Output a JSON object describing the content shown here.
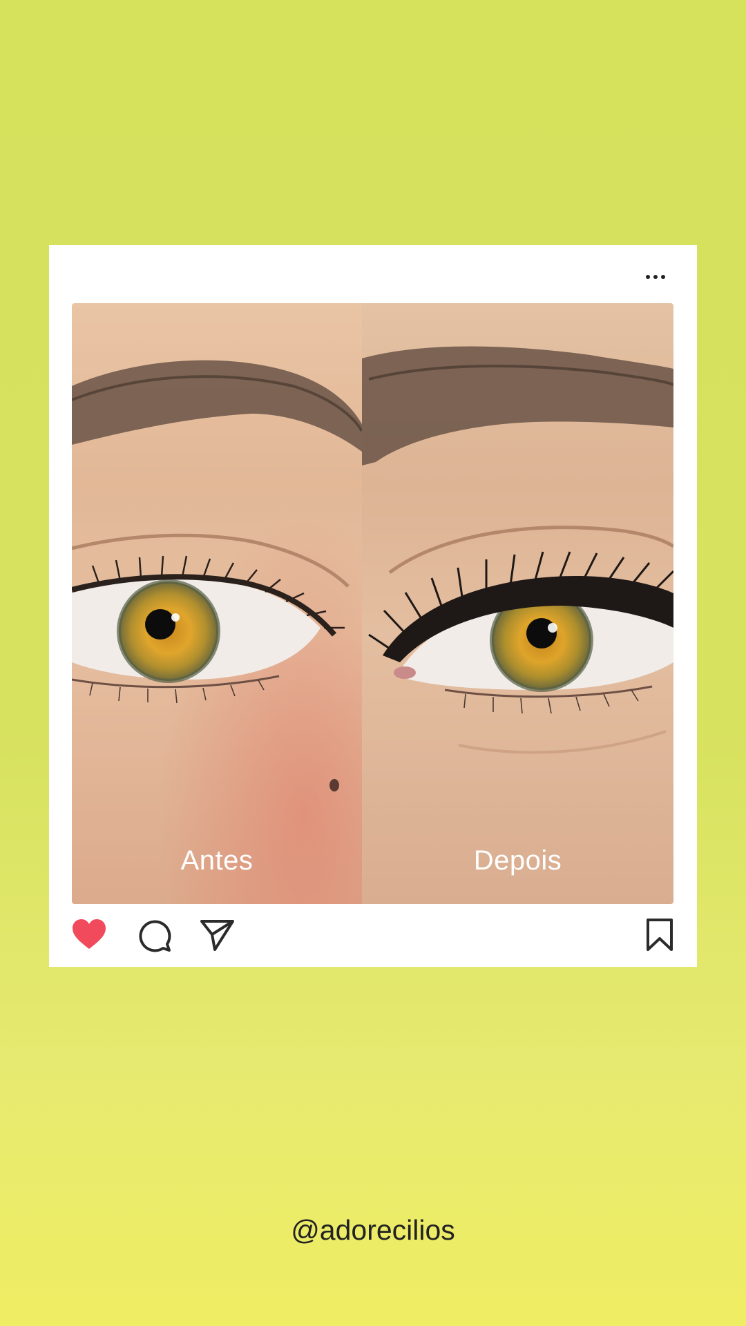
{
  "post": {
    "menu_icon": "more-dots-icon",
    "photo": {
      "before_label": "Antes",
      "after_label": "Depois"
    },
    "actions": {
      "like_icon": "heart-icon",
      "liked": true,
      "like_color": "#f04a5c",
      "comment_icon": "comment-icon",
      "share_icon": "send-icon",
      "save_icon": "bookmark-icon"
    }
  },
  "handle": "@adorecilios",
  "colors": {
    "background_top": "#d6e15c",
    "background_bottom": "#efed63",
    "card": "#ffffff",
    "icon_stroke": "#2b2b2b"
  }
}
